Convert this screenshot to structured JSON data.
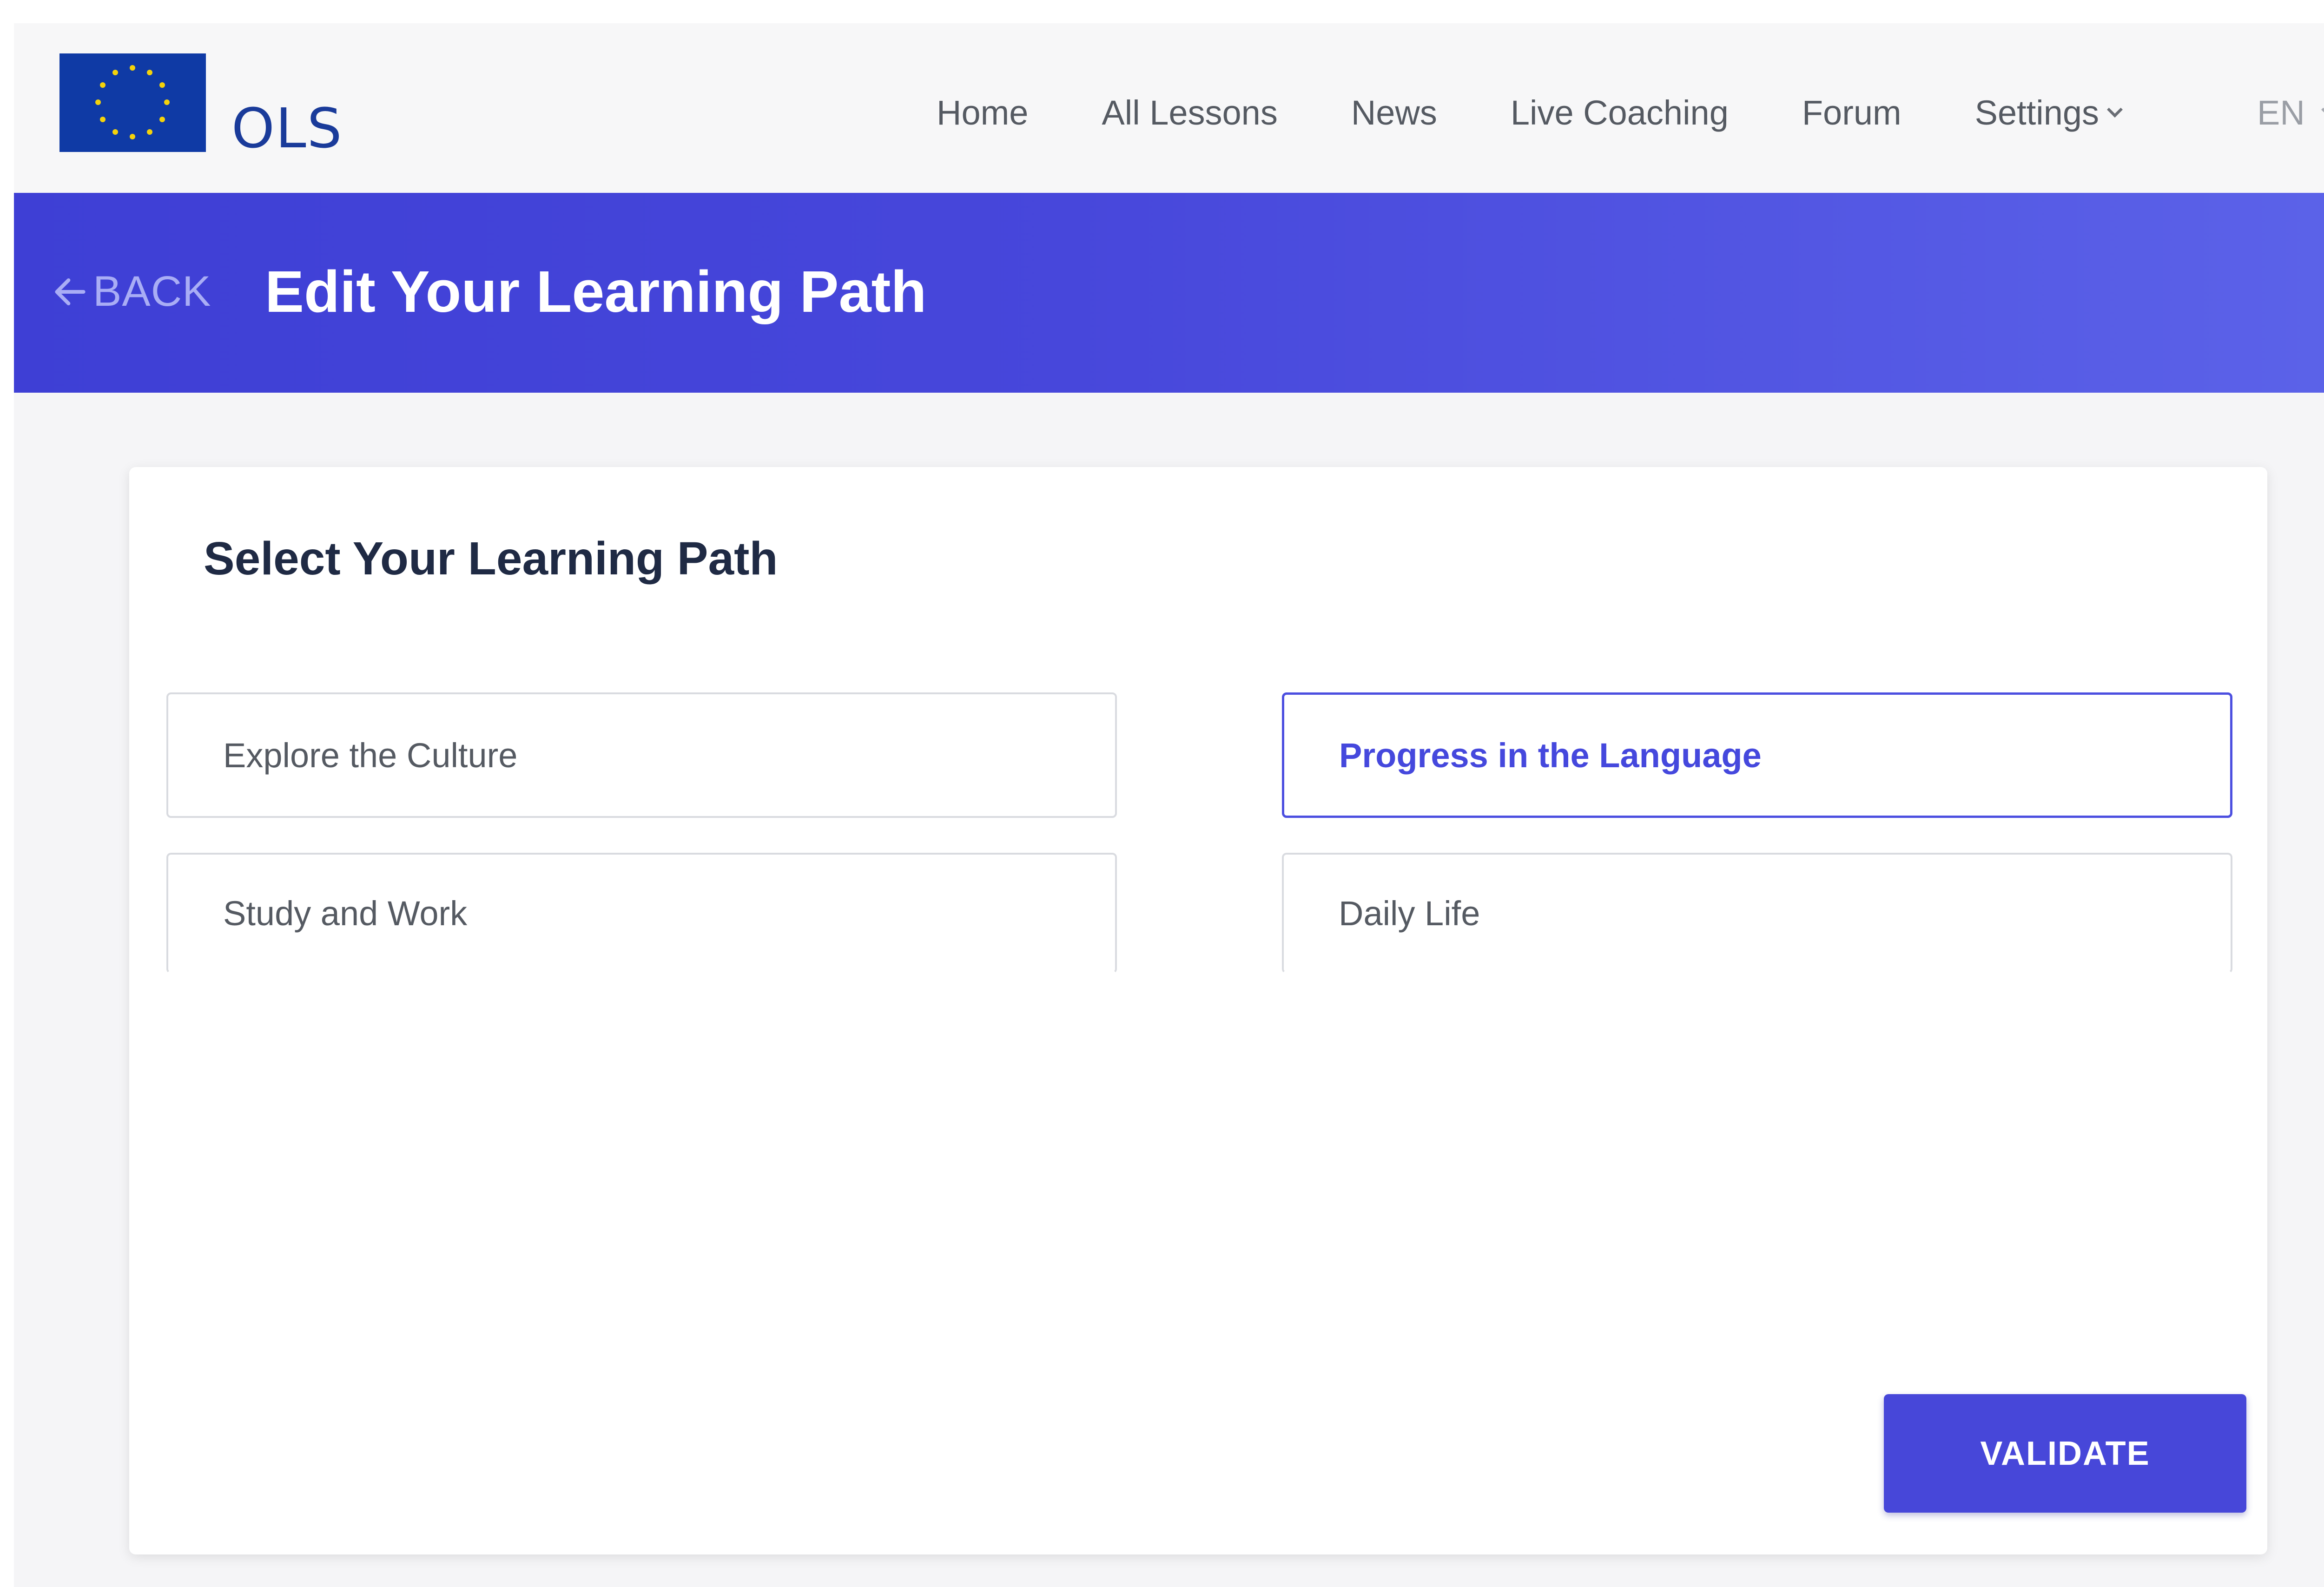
{
  "header": {
    "logo_text": "OLS",
    "nav": [
      {
        "label": "Home"
      },
      {
        "label": "All Lessons"
      },
      {
        "label": "News"
      },
      {
        "label": "Live Coaching"
      },
      {
        "label": "Forum"
      },
      {
        "label": "Settings"
      }
    ],
    "language": "EN"
  },
  "banner": {
    "back_label": "BACK",
    "title": "Edit Your Learning Path"
  },
  "card": {
    "title": "Select Your Learning Path",
    "options": [
      {
        "label": "Explore the Culture"
      },
      {
        "label": "Progress in the Language"
      },
      {
        "label": "Study and Work"
      },
      {
        "label": "Daily Life"
      }
    ],
    "validate_label": "VALIDATE"
  },
  "colors": {
    "brand_blue": "#4747d9",
    "eu_flag_blue": "#0f3aa5",
    "eu_star_yellow": "#f3d20b",
    "selected_border": "#4c4fe0"
  },
  "icons": {
    "logo": "eu-flag-icon",
    "back": "arrow-left-icon",
    "dropdown": "chevron-down-icon"
  }
}
